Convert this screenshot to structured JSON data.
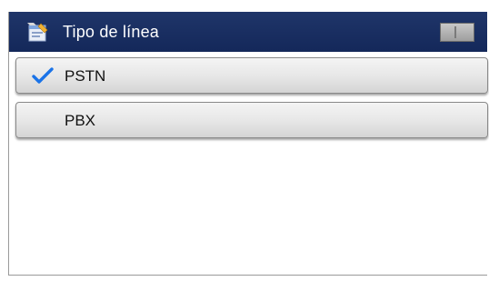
{
  "header": {
    "title": "Tipo de línea",
    "icon": "settings-document-icon"
  },
  "options": [
    {
      "label": "PSTN",
      "selected": true
    },
    {
      "label": "PBX",
      "selected": false
    }
  ],
  "colors": {
    "header_background": "#1a2f63",
    "check": "#1a73e8",
    "button": "#e6e6e6"
  }
}
